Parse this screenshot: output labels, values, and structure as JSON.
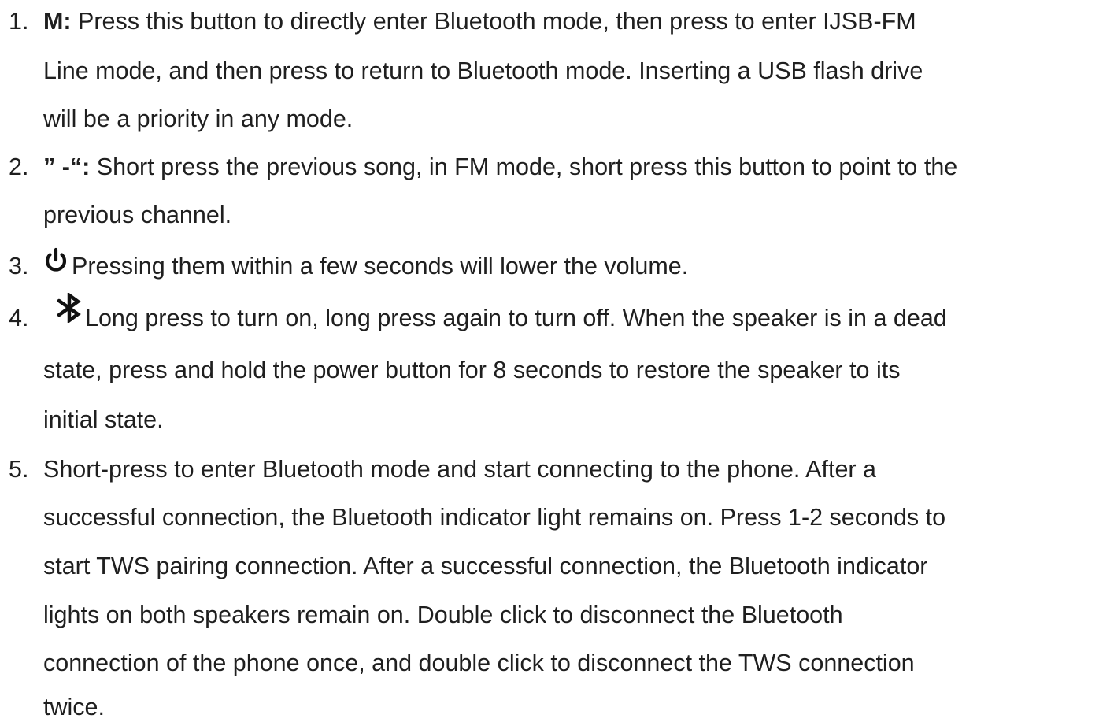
{
  "items": [
    {
      "number": "1.",
      "key": "M:",
      "lines": [
        " Press this button to directly enter Bluetooth mode, then press to enter IJSB-FM",
        "Line mode, and then press to return to Bluetooth mode. Inserting a USB flash drive",
        "will be a priority in any mode."
      ]
    },
    {
      "number": "2.",
      "key": "” -“:",
      "lines": [
        " Short press the previous song, in FM mode, short press this button to point to the",
        "previous channel."
      ]
    },
    {
      "number": "3.",
      "icon": "power-icon",
      "lines": [
        "Pressing them within a few seconds will lower the volume."
      ]
    },
    {
      "number": "4.",
      "icon": "bluetooth-icon",
      "lines": [
        "Long press to turn on, long press again to turn off. When the speaker is in a dead",
        "state, press and hold the power button for 8 seconds to restore the speaker to its",
        "initial state."
      ]
    },
    {
      "number": "5.",
      "lines": [
        "Short-press to enter Bluetooth mode and start connecting to the phone. After a",
        "successful connection, the Bluetooth indicator light remains on. Press 1-2 seconds to",
        "start TWS pairing connection. After a successful connection, the Bluetooth indicator",
        "lights on both speakers remain on. Double click to disconnect the Bluetooth",
        "connection of the phone once, and double click to disconnect the TWS connection",
        "twice."
      ]
    }
  ]
}
